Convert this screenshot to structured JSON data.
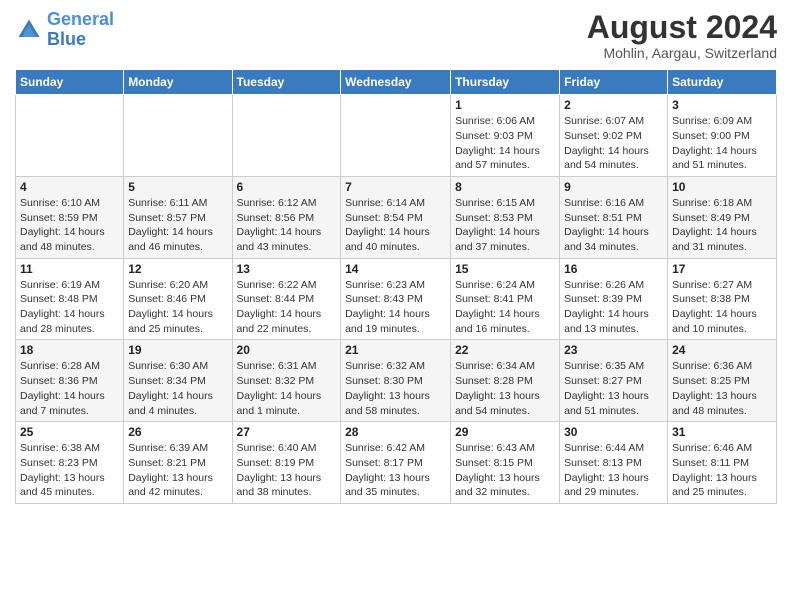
{
  "logo": {
    "text_general": "General",
    "text_blue": "Blue"
  },
  "header": {
    "month_year": "August 2024",
    "location": "Mohlin, Aargau, Switzerland"
  },
  "weekdays": [
    "Sunday",
    "Monday",
    "Tuesday",
    "Wednesday",
    "Thursday",
    "Friday",
    "Saturday"
  ],
  "weeks": [
    [
      {
        "day": "",
        "info": ""
      },
      {
        "day": "",
        "info": ""
      },
      {
        "day": "",
        "info": ""
      },
      {
        "day": "",
        "info": ""
      },
      {
        "day": "1",
        "info": "Sunrise: 6:06 AM\nSunset: 9:03 PM\nDaylight: 14 hours\nand 57 minutes."
      },
      {
        "day": "2",
        "info": "Sunrise: 6:07 AM\nSunset: 9:02 PM\nDaylight: 14 hours\nand 54 minutes."
      },
      {
        "day": "3",
        "info": "Sunrise: 6:09 AM\nSunset: 9:00 PM\nDaylight: 14 hours\nand 51 minutes."
      }
    ],
    [
      {
        "day": "4",
        "info": "Sunrise: 6:10 AM\nSunset: 8:59 PM\nDaylight: 14 hours\nand 48 minutes."
      },
      {
        "day": "5",
        "info": "Sunrise: 6:11 AM\nSunset: 8:57 PM\nDaylight: 14 hours\nand 46 minutes."
      },
      {
        "day": "6",
        "info": "Sunrise: 6:12 AM\nSunset: 8:56 PM\nDaylight: 14 hours\nand 43 minutes."
      },
      {
        "day": "7",
        "info": "Sunrise: 6:14 AM\nSunset: 8:54 PM\nDaylight: 14 hours\nand 40 minutes."
      },
      {
        "day": "8",
        "info": "Sunrise: 6:15 AM\nSunset: 8:53 PM\nDaylight: 14 hours\nand 37 minutes."
      },
      {
        "day": "9",
        "info": "Sunrise: 6:16 AM\nSunset: 8:51 PM\nDaylight: 14 hours\nand 34 minutes."
      },
      {
        "day": "10",
        "info": "Sunrise: 6:18 AM\nSunset: 8:49 PM\nDaylight: 14 hours\nand 31 minutes."
      }
    ],
    [
      {
        "day": "11",
        "info": "Sunrise: 6:19 AM\nSunset: 8:48 PM\nDaylight: 14 hours\nand 28 minutes."
      },
      {
        "day": "12",
        "info": "Sunrise: 6:20 AM\nSunset: 8:46 PM\nDaylight: 14 hours\nand 25 minutes."
      },
      {
        "day": "13",
        "info": "Sunrise: 6:22 AM\nSunset: 8:44 PM\nDaylight: 14 hours\nand 22 minutes."
      },
      {
        "day": "14",
        "info": "Sunrise: 6:23 AM\nSunset: 8:43 PM\nDaylight: 14 hours\nand 19 minutes."
      },
      {
        "day": "15",
        "info": "Sunrise: 6:24 AM\nSunset: 8:41 PM\nDaylight: 14 hours\nand 16 minutes."
      },
      {
        "day": "16",
        "info": "Sunrise: 6:26 AM\nSunset: 8:39 PM\nDaylight: 14 hours\nand 13 minutes."
      },
      {
        "day": "17",
        "info": "Sunrise: 6:27 AM\nSunset: 8:38 PM\nDaylight: 14 hours\nand 10 minutes."
      }
    ],
    [
      {
        "day": "18",
        "info": "Sunrise: 6:28 AM\nSunset: 8:36 PM\nDaylight: 14 hours\nand 7 minutes."
      },
      {
        "day": "19",
        "info": "Sunrise: 6:30 AM\nSunset: 8:34 PM\nDaylight: 14 hours\nand 4 minutes."
      },
      {
        "day": "20",
        "info": "Sunrise: 6:31 AM\nSunset: 8:32 PM\nDaylight: 14 hours\nand 1 minute."
      },
      {
        "day": "21",
        "info": "Sunrise: 6:32 AM\nSunset: 8:30 PM\nDaylight: 13 hours\nand 58 minutes."
      },
      {
        "day": "22",
        "info": "Sunrise: 6:34 AM\nSunset: 8:28 PM\nDaylight: 13 hours\nand 54 minutes."
      },
      {
        "day": "23",
        "info": "Sunrise: 6:35 AM\nSunset: 8:27 PM\nDaylight: 13 hours\nand 51 minutes."
      },
      {
        "day": "24",
        "info": "Sunrise: 6:36 AM\nSunset: 8:25 PM\nDaylight: 13 hours\nand 48 minutes."
      }
    ],
    [
      {
        "day": "25",
        "info": "Sunrise: 6:38 AM\nSunset: 8:23 PM\nDaylight: 13 hours\nand 45 minutes."
      },
      {
        "day": "26",
        "info": "Sunrise: 6:39 AM\nSunset: 8:21 PM\nDaylight: 13 hours\nand 42 minutes."
      },
      {
        "day": "27",
        "info": "Sunrise: 6:40 AM\nSunset: 8:19 PM\nDaylight: 13 hours\nand 38 minutes."
      },
      {
        "day": "28",
        "info": "Sunrise: 6:42 AM\nSunset: 8:17 PM\nDaylight: 13 hours\nand 35 minutes."
      },
      {
        "day": "29",
        "info": "Sunrise: 6:43 AM\nSunset: 8:15 PM\nDaylight: 13 hours\nand 32 minutes."
      },
      {
        "day": "30",
        "info": "Sunrise: 6:44 AM\nSunset: 8:13 PM\nDaylight: 13 hours\nand 29 minutes."
      },
      {
        "day": "31",
        "info": "Sunrise: 6:46 AM\nSunset: 8:11 PM\nDaylight: 13 hours\nand 25 minutes."
      }
    ]
  ]
}
